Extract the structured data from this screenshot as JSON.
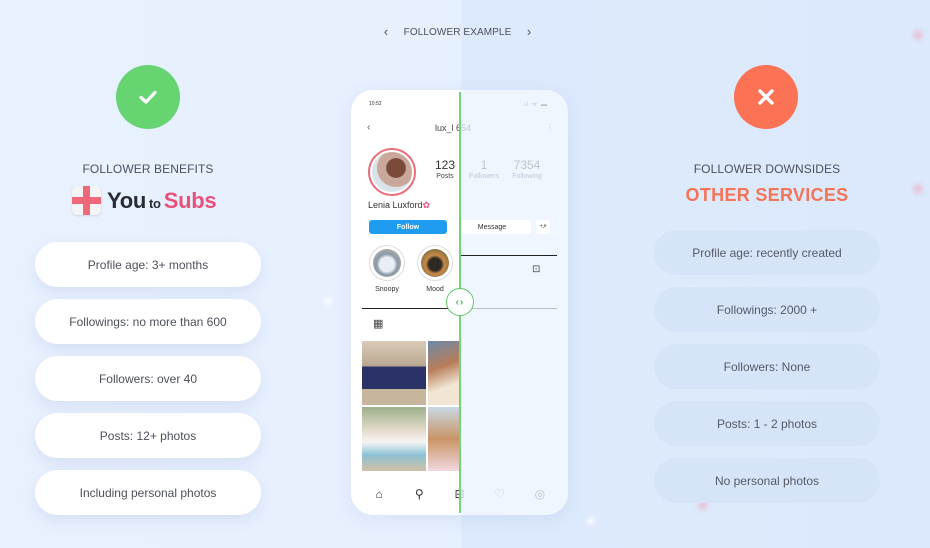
{
  "nav": {
    "prev_icon": "chevron-left-icon",
    "title": "FOLLOWER EXAMPLE",
    "next_icon": "chevron-right-icon"
  },
  "left": {
    "badge_icon": "checkmark-icon",
    "heading": "FOLLOWER BENEFITS",
    "brand": {
      "you": "You",
      "to": "to",
      "subs": "Subs",
      "logo_icon": "gift-icon"
    },
    "items": [
      "Profile age: 3+ months",
      "Followings: no more than 600",
      "Followers: over 40",
      "Posts: 12+ photos",
      "Including personal photos"
    ]
  },
  "right": {
    "badge_icon": "close-x-icon",
    "heading": "FOLLOWER DOWNSIDES",
    "title": "OTHER SERVICES",
    "items": [
      "Profile age: recently created",
      "Followings: 2000 +",
      "Followers: None",
      "Posts: 1 - 2 photos",
      "No personal photos"
    ]
  },
  "phone": {
    "time": "10:52",
    "status_icons": ".ıl ᯤ ▬",
    "back": "‹",
    "username": "lux_l   654",
    "more": "⋮",
    "stats": [
      {
        "value": "123",
        "label": "Posts"
      },
      {
        "value": "1",
        "label": "Followers"
      },
      {
        "value": "7354",
        "label": "Following"
      }
    ],
    "name": "Lenia Luxford",
    "name_emoji": "✿",
    "follow_label": "Follow",
    "message_label": "Message",
    "add_user": "+ዖ",
    "stories": [
      {
        "label": "Snoopy"
      },
      {
        "label": "Mood"
      }
    ],
    "grid_icon": "▦",
    "tag_icon": "⊡",
    "nav_icons": [
      "⌂",
      "⚲",
      "⊞",
      "♡",
      "◎"
    ]
  },
  "colors": {
    "good": "#67d472",
    "bad": "#fb7255",
    "brand_pink": "#e9517a",
    "follow_blue": "#1f9bf0",
    "slider_green": "#74d27a"
  }
}
